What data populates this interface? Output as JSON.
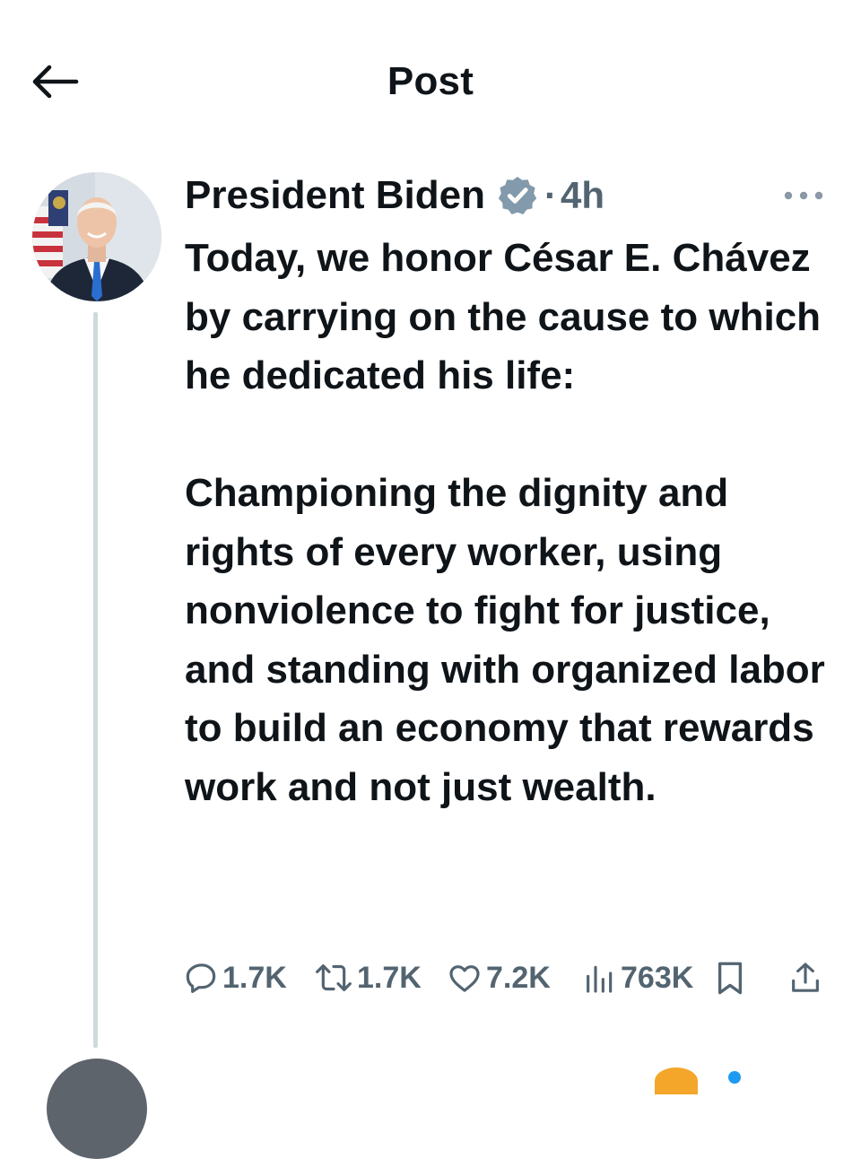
{
  "header": {
    "title": "Post",
    "back_icon": "arrow-left-icon"
  },
  "post": {
    "author": {
      "name": "President Biden",
      "verified_icon": "verified-badge-icon",
      "verified_color": "#829aab"
    },
    "separator": "·",
    "time": "4h",
    "more_icon": "more-horizontal-icon",
    "text": "Today, we honor César E. Chávez by carrying on the cause to which he dedicated his life:\n\nChampioning the dignity and rights of every worker, using nonviolence to fight for justice, and standing with organized labor to build an economy that rewards work and not just wealth.",
    "actions": {
      "replies": {
        "icon": "reply-icon",
        "count": "1.7K"
      },
      "reposts": {
        "icon": "repost-icon",
        "count": "1.7K"
      },
      "likes": {
        "icon": "heart-icon",
        "count": "7.2K"
      },
      "views": {
        "icon": "views-icon",
        "count": "763K"
      },
      "bookmark": {
        "icon": "bookmark-icon"
      },
      "share": {
        "icon": "share-icon"
      }
    }
  },
  "colors": {
    "text_primary": "#0f1419",
    "text_secondary": "#536471",
    "thread_line": "#cfd9de",
    "accent": "#1d9bf0"
  }
}
